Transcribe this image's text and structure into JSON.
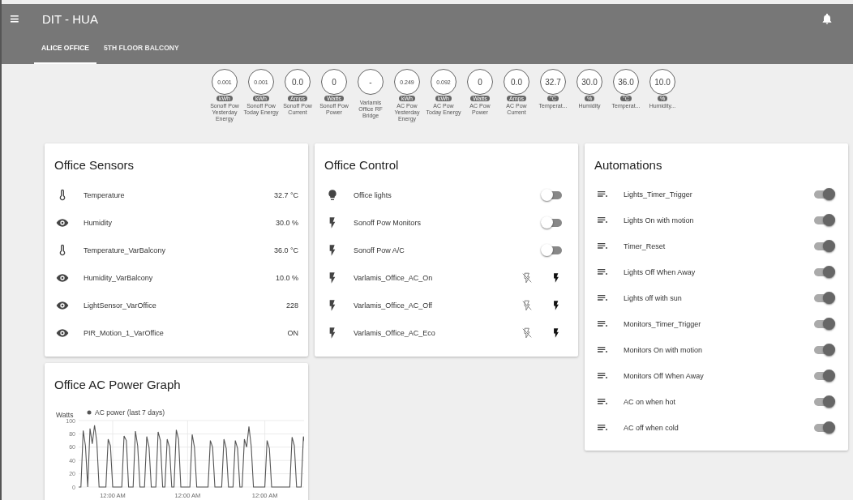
{
  "app_bar": {
    "menu_icon": "≡",
    "title": "DIT - HUA"
  },
  "tabs": [
    {
      "label": "ALICE OFFICE",
      "selected": true
    },
    {
      "label": "5TH FLOOR BALCONY",
      "selected": false
    }
  ],
  "badges": [
    {
      "value": "0.001",
      "unit": "kWh",
      "name": "Sonoff Pow Yesterday Energy"
    },
    {
      "value": "0.001",
      "unit": "kWh",
      "name": "Sonoff Pow Today Energy"
    },
    {
      "value": "0.0",
      "unit": "Amps",
      "name": "Sonoff Pow Current"
    },
    {
      "value": "0",
      "unit": "Watts",
      "name": "Sonoff Pow Power"
    },
    {
      "value": "-",
      "name": "Varlamis Office RF Bridge"
    },
    {
      "value": "0.249",
      "unit": "kWh",
      "name": "AC Pow Yesterday Energy"
    },
    {
      "value": "0.092",
      "unit": "kWh",
      "name": "AC Pow Today Energy"
    },
    {
      "value": "0",
      "unit": "Watts",
      "name": "AC Pow Power"
    },
    {
      "value": "0.0",
      "unit": "Amps",
      "name": "AC Pow Current"
    },
    {
      "value": "32.7",
      "unit": "°C",
      "name": "Temperat..."
    },
    {
      "value": "30.0",
      "unit": "%",
      "name": "Humidity"
    },
    {
      "value": "36.0",
      "unit": "°C",
      "name": "Temperat..."
    },
    {
      "value": "10.0",
      "unit": "%",
      "name": "Humidity..."
    }
  ],
  "cards": [
    {
      "title": "Office Sensors",
      "rows": [
        {
          "kind": "thermo",
          "name": "Temperature",
          "state": "32.7 °C"
        },
        {
          "kind": "eye",
          "name": "Humidity",
          "state": "30.0 %"
        },
        {
          "kind": "thermo",
          "name": "Temperature_VarBalcony",
          "state": "36.0 °C"
        },
        {
          "kind": "eye",
          "name": "Humidity_VarBalcony",
          "state": "10.0 %"
        },
        {
          "kind": "eye",
          "name": "LightSensor_VarOffice",
          "state": "228"
        },
        {
          "kind": "eye",
          "name": "PIR_Motion_1_VarOffice",
          "state": "ON"
        }
      ]
    },
    {
      "title": "Office Control",
      "rows": [
        {
          "kind": "light",
          "name": "Office lights",
          "on": false
        },
        {
          "kind": "switch",
          "name": "Sonoff Pow Monitors",
          "on": false
        },
        {
          "kind": "switch",
          "name": "Sonoff Pow A/C",
          "on": false
        },
        {
          "kind": "scene",
          "name": "Varlamis_Office_AC_On"
        },
        {
          "kind": "scene",
          "name": "Varlamis_Office_AC_Off"
        },
        {
          "kind": "scene",
          "name": "Varlamis_Office_AC_Eco"
        }
      ]
    },
    {
      "title": "Automations",
      "rows": [
        {
          "kind": "automation",
          "name": "Lights_Timer_Trigger",
          "on": true
        },
        {
          "kind": "automation",
          "name": "Lights On with motion",
          "on": true
        },
        {
          "kind": "automation",
          "name": "Timer_Reset",
          "on": true
        },
        {
          "kind": "automation",
          "name": "Lights Off When Away",
          "on": true
        },
        {
          "kind": "automation",
          "name": "Lights off with sun",
          "on": true
        },
        {
          "kind": "automation",
          "name": "Monitors_Timer_Trigger",
          "on": true
        },
        {
          "kind": "automation",
          "name": "Monitors On with motion",
          "on": true
        },
        {
          "kind": "automation",
          "name": "Monitors Off When Away",
          "on": true
        },
        {
          "kind": "automation",
          "name": "AC on when hot",
          "on": true
        },
        {
          "kind": "automation",
          "name": "AC off when cold",
          "on": true
        }
      ]
    }
  ],
  "graph_card": {
    "title": "Office AC Power Graph",
    "chart_data": {
      "type": "line",
      "ylabel": "Watts",
      "categories": [
        null,
        null,
        null,
        null,
        null,
        null,
        null,
        null,
        null,
        null,
        null,
        null,
        null,
        null,
        null,
        "12:00 AM",
        null,
        null,
        null,
        null,
        null,
        null,
        null,
        null,
        null,
        null,
        null,
        null,
        null,
        null,
        null,
        null,
        null,
        null,
        null,
        null,
        null,
        null,
        null,
        null,
        null,
        null,
        null,
        null,
        null,
        null,
        null,
        null,
        "12:00 AM",
        null,
        null,
        null,
        null,
        null,
        null,
        null,
        null,
        null,
        null,
        null,
        null,
        null,
        null,
        null,
        null,
        null,
        null,
        null,
        null,
        null,
        null,
        null,
        null,
        null,
        null,
        null,
        null,
        null,
        null,
        null,
        null,
        null,
        "12:00 AM",
        null,
        null,
        null,
        null,
        null,
        null,
        null,
        null,
        null,
        null,
        null,
        null,
        null,
        null,
        null,
        null,
        null,
        null
      ],
      "series": [
        {
          "name": "AC power (last 7 days)",
          "color": "#555555",
          "values": [
            0,
            0,
            85,
            62,
            0,
            88,
            65,
            93,
            68,
            0,
            0,
            0,
            0,
            72,
            62,
            0,
            0,
            0,
            0,
            0,
            77,
            70,
            0,
            0,
            0,
            84,
            62,
            0,
            0,
            0,
            76,
            60,
            0,
            0,
            0,
            83,
            70,
            0,
            0,
            72,
            60,
            0,
            0,
            86,
            72,
            0,
            0,
            0,
            0,
            0,
            79,
            60,
            0,
            0,
            0,
            0,
            0,
            0,
            70,
            60,
            0,
            0,
            0,
            0,
            72,
            58,
            0,
            0,
            0,
            70,
            58,
            0,
            0,
            72,
            60,
            91,
            62,
            0,
            0,
            0,
            0,
            0,
            0,
            70,
            58,
            0,
            0,
            0,
            0,
            0,
            0,
            0,
            0,
            0,
            75,
            62,
            0,
            0,
            0,
            76,
            60
          ]
        }
      ],
      "grid": true,
      "ylim": [
        0,
        100
      ],
      "yticks": [
        0,
        20,
        40,
        60,
        80,
        100
      ]
    }
  }
}
